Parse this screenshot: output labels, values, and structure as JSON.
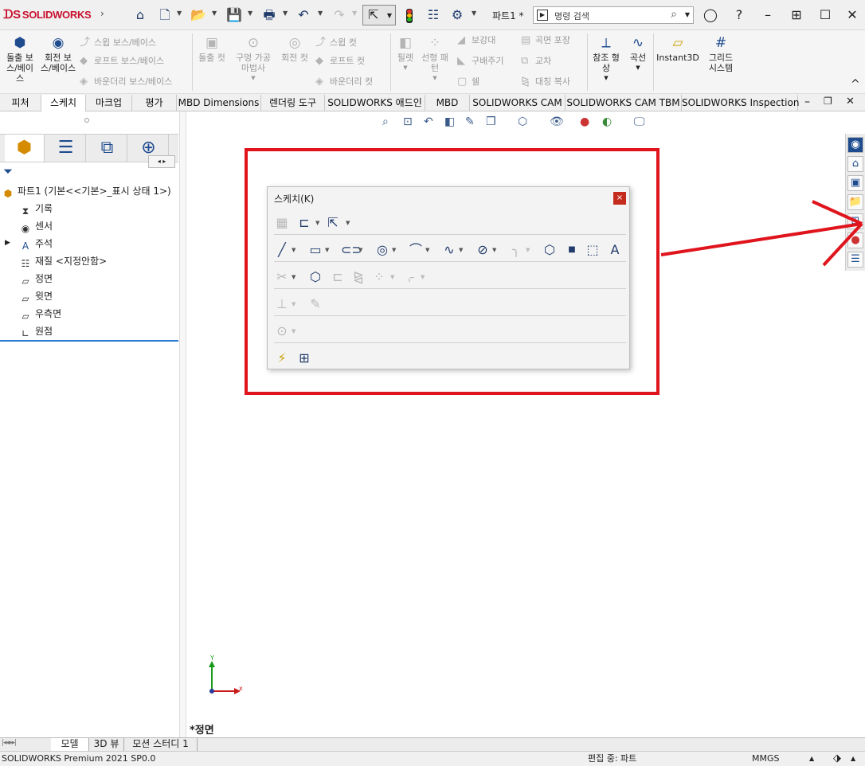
{
  "app": {
    "brand": "SOLIDWORKS",
    "doc_title": "파트1 *"
  },
  "search": {
    "placeholder": "명령 검색"
  },
  "ribbon": {
    "extrude_boss": "돌출 보스/베이스",
    "revolve_boss": "회전 보스/베이스",
    "swept_boss": "스윕 보스/베이스",
    "loft_boss": "로프트 보스/베이스",
    "boundary_boss": "바운더리 보스/베이스",
    "extrude_cut": "돌출 컷",
    "hole_wizard": "구멍 가공 마법사",
    "revolve_cut": "회전 컷",
    "swept_cut": "스윕 컷",
    "loft_cut": "로프트 컷",
    "boundary_cut": "바운더리 컷",
    "fillet": "필렛",
    "linear_pattern": "선형 패턴",
    "rib": "보강대",
    "draft": "구배주기",
    "shell": "쉘",
    "wrap": "곡면 포장",
    "intersect": "교차",
    "mirror": "대칭 복사",
    "ref_geometry": "참조 형상",
    "curves": "곡선",
    "instant3d": "Instant3D",
    "grid_system": "그리드 시스템"
  },
  "tabs": [
    "피처",
    "스케치",
    "마크업",
    "평가",
    "MBD Dimensions",
    "렌더링 도구",
    "SOLIDWORKS 애드인",
    "MBD",
    "SOLIDWORKS CAM",
    "SOLIDWORKS CAM TBM",
    "SOLIDWORKS Inspection"
  ],
  "tree": {
    "root": "파트1  (기본<<기본>_표시 상태 1>)",
    "items": [
      "기록",
      "센서",
      "주석",
      "재질 <지정안함>",
      "정면",
      "윗면",
      "우측면",
      "원점"
    ]
  },
  "dialog": {
    "title": "스케치(K)",
    "close": "×"
  },
  "view": {
    "label": "*정면",
    "axis_x": "x",
    "axis_y": "Y"
  },
  "bottom_tabs": [
    "모델",
    "3D 뷰",
    "모션 스터디 1"
  ],
  "status": {
    "product": "SOLIDWORKS Premium 2021 SP0.0",
    "mode": "편집 중: 파트",
    "units": "MMGS"
  },
  "colors": {
    "brand_red": "#c8102e",
    "highlight_red": "#e0141c",
    "icon_blue": "#1f4c8f"
  },
  "icons": {
    "home": "home-icon",
    "new": "new-document-icon",
    "open": "open-folder-icon",
    "save": "save-icon",
    "print": "print-icon",
    "undo": "undo-icon",
    "redo": "redo-icon",
    "select": "select-arrow-icon",
    "rebuild": "traffic-light-icon",
    "file_props": "file-properties-icon",
    "options": "gear-icon",
    "user": "user-icon",
    "help": "help-icon"
  }
}
